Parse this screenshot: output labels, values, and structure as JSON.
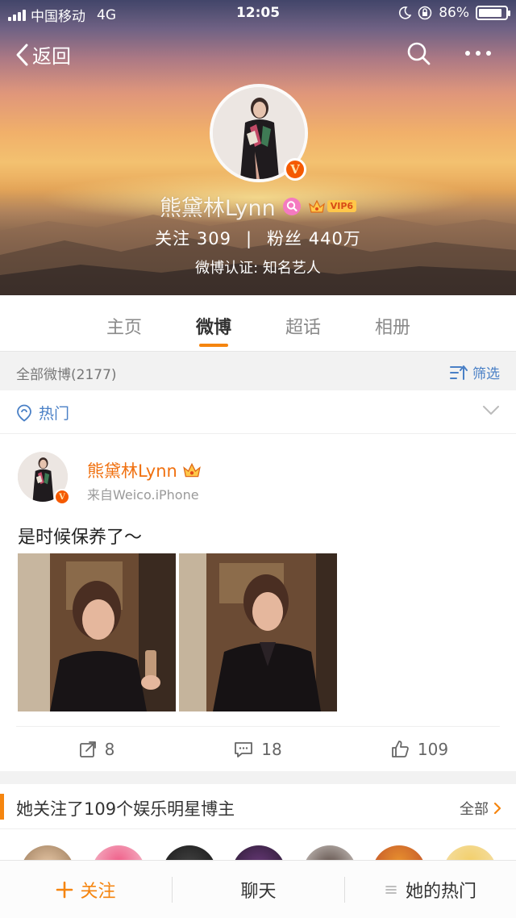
{
  "status_bar": {
    "carrier": "中国移动",
    "network": "4G",
    "time": "12:05",
    "battery": "86%",
    "battery_level": 0.86
  },
  "nav": {
    "back_label": "返回"
  },
  "profile": {
    "name": "熊黛林Lynn",
    "vip_level": "VIP6",
    "following_label": "关注",
    "following_count": "309",
    "separator": "|",
    "fans_label": "粉丝",
    "fans_count": "440万",
    "verification": "微博认证: 知名艺人",
    "verified_badge": "V"
  },
  "tabs": [
    {
      "label": "主页",
      "active": false
    },
    {
      "label": "微博",
      "active": true
    },
    {
      "label": "超话",
      "active": false
    },
    {
      "label": "相册",
      "active": false
    }
  ],
  "filter": {
    "count_text": "全部微博(2177)",
    "filter_label": "筛选"
  },
  "hot": {
    "label": "热门"
  },
  "post": {
    "author": "熊黛林Lynn",
    "source": "来自Weico.iPhone",
    "text": "是时候保养了～",
    "reposts": "8",
    "comments": "18",
    "likes": "109"
  },
  "follow_section": {
    "title": "她关注了109个娱乐明星博主",
    "all_label": "全部"
  },
  "bottom_bar": {
    "follow_label": "关注",
    "chat_label": "聊天",
    "hot_label": "她的热门"
  },
  "colors": {
    "accent": "#f5850f",
    "link_blue": "#4a80c6",
    "verified_orange": "#f55a00"
  }
}
